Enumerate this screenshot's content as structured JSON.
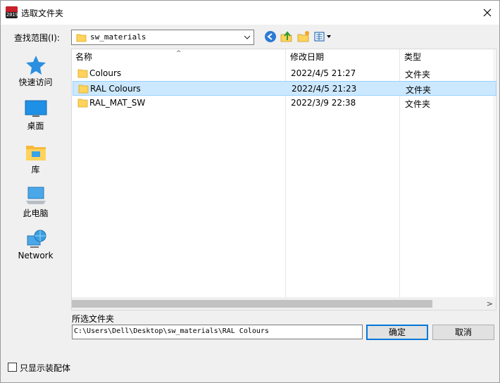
{
  "window": {
    "title": "选取文件夹",
    "app_icon_text": "2019",
    "close_icon": "close-icon"
  },
  "lookin": {
    "label": "查找范围(I):",
    "value": "sw_materials"
  },
  "toolbar": {
    "icons": [
      "back-icon",
      "up-folder-icon",
      "new-folder-icon",
      "view-menu-icon"
    ]
  },
  "places": [
    {
      "label": "快速访问",
      "icon": "quick-access-icon"
    },
    {
      "label": "桌面",
      "icon": "desktop-icon"
    },
    {
      "label": "库",
      "icon": "library-icon"
    },
    {
      "label": "此电脑",
      "icon": "computer-icon"
    },
    {
      "label": "Network",
      "icon": "network-icon"
    }
  ],
  "list": {
    "columns": [
      "名称",
      "修改日期",
      "类型"
    ],
    "rows": [
      {
        "name": "Colours",
        "date": "2022/4/5 21:27",
        "type": "文件夹",
        "selected": false
      },
      {
        "name": "RAL Colours",
        "date": "2022/4/5 21:23",
        "type": "文件夹",
        "selected": true
      },
      {
        "name": "RAL_MAT_SW",
        "date": "2022/3/9 22:38",
        "type": "文件夹",
        "selected": false
      }
    ]
  },
  "selection": {
    "label": "所选文件夹",
    "path": "C:\\Users\\Dell\\Desktop\\sw_materials\\RAL Colours"
  },
  "buttons": {
    "ok": "确定",
    "cancel": "取消"
  },
  "assembly_only": {
    "label": "只显示装配体",
    "checked": false
  },
  "colors": {
    "selection_bg": "#cce8ff",
    "selection_border": "#99d1ff",
    "folder_yellow": "#ffd35c",
    "accent": "#0078d7"
  }
}
